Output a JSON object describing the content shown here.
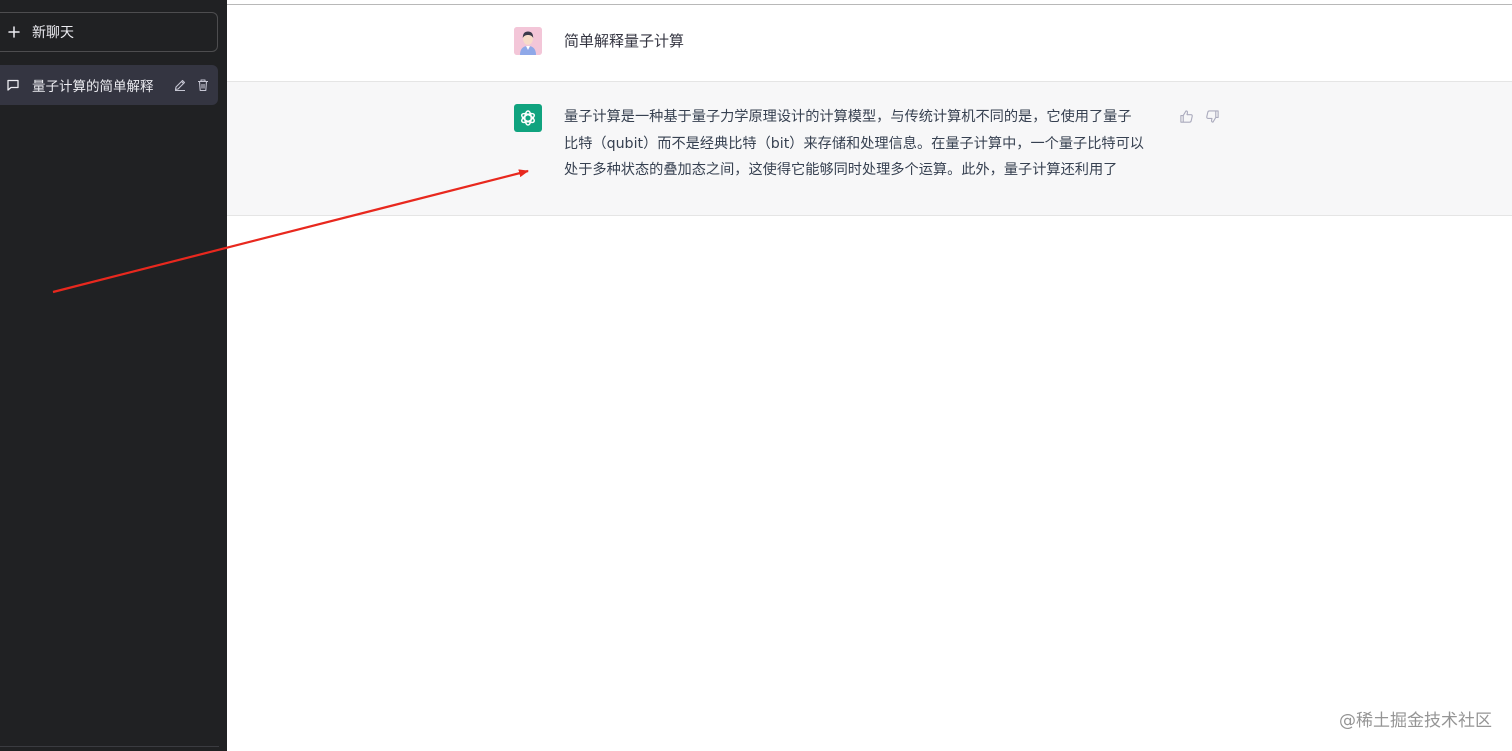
{
  "sidebar": {
    "new_chat_label": "新聊天",
    "conversations": [
      {
        "title": "量子计算的简单解释"
      }
    ]
  },
  "chat": {
    "user_message": "简单解释量子计算",
    "assistant_lines": [
      "量子计算是一种基于量子力学原理设计的计算模型，与传统计算机不同的是，它使用了量子",
      "比特（qubit）而不是经典比特（bit）来存储和处理信息。在量子计算中，一个量子比特可以",
      "处于多种状态的叠加态之间，这使得它能够同时处理多个运算。此外，量子计算还利用了"
    ]
  },
  "icons": {
    "new_chat": "plus-icon",
    "conversation": "chat-bubble-icon",
    "edit": "pencil-icon",
    "delete": "trash-icon",
    "user_avatar": "user-avatar-icon",
    "assistant_avatar": "openai-logo-icon",
    "like": "thumbs-up-icon",
    "dislike": "thumbs-down-icon"
  },
  "colors": {
    "sidebar_bg": "#202123",
    "selected_item_bg": "#343541",
    "assistant_row_bg": "#f7f7f8",
    "assistant_avatar_bg": "#10a37f",
    "annotation_arrow": "#e8281e"
  },
  "watermark": "@稀土掘金技术社区"
}
